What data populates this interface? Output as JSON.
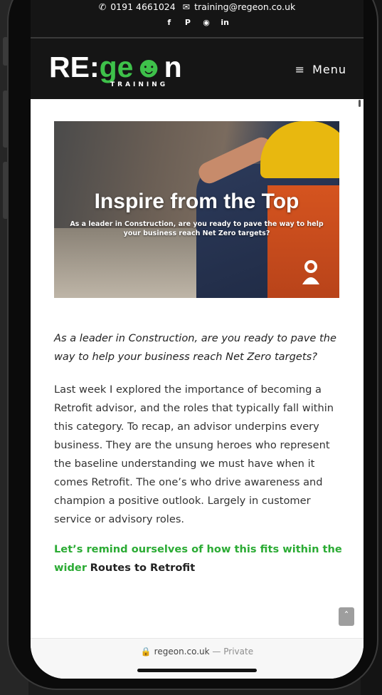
{
  "topbar": {
    "phone_icon": "phone-icon",
    "phone": "0191 4661024",
    "email_icon": "mail-icon",
    "email": "training@regeon.co.uk",
    "social": [
      "facebook-icon",
      "pinterest-icon",
      "instagram-icon",
      "linkedin-icon"
    ]
  },
  "header": {
    "logo_main_1": "RE:",
    "logo_main_2": "ge",
    "logo_main_3": "n",
    "logo_sub": "TRAINING",
    "menu_label": "Menu",
    "menu_icon": "hamburger-icon"
  },
  "hero": {
    "title": "Inspire from the Top",
    "subtitle": "As a leader in Construction, are you ready to pave the way to help your business reach Net Zero targets?",
    "badge_icon": "user-icon"
  },
  "article": {
    "lead": "As a leader in Construction, are you ready to pave the way to help your business reach Net Zero targets?",
    "paragraph": "Last week I explored the importance of becoming a Retrofit advisor, and the roles that typically fall within this category. To recap, an advisor underpins every business. They are the unsung heroes who represent the baseline understanding we must have when it comes Retrofit. The one’s who drive awareness and champion a positive outlook. Largely in customer service or advisory roles.",
    "highlight_green": "Let’s remind ourselves of how this fits within the wider",
    "highlight_dark": "Routes to Retrofit"
  },
  "browser": {
    "lock_icon": "lock-icon",
    "domain": "regeon.co.uk",
    "separator": "—",
    "mode": "Private"
  },
  "scroll_top_icon": "chevron-up-icon",
  "colors": {
    "brand_green": "#2bab34",
    "header_bg": "#151515"
  }
}
